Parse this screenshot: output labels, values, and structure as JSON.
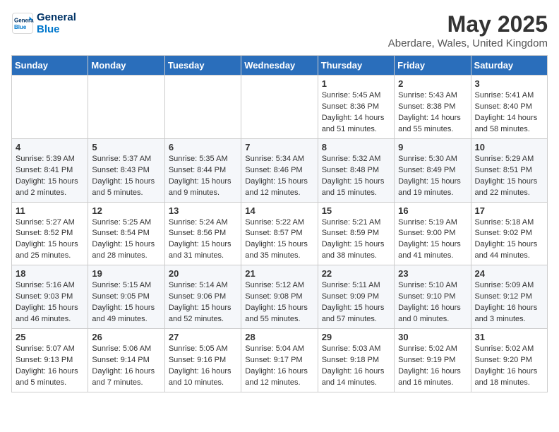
{
  "logo": {
    "line1": "General",
    "line2": "Blue"
  },
  "title": "May 2025",
  "location": "Aberdare, Wales, United Kingdom",
  "days_of_week": [
    "Sunday",
    "Monday",
    "Tuesday",
    "Wednesday",
    "Thursday",
    "Friday",
    "Saturday"
  ],
  "weeks": [
    [
      {
        "day": "",
        "sunrise": "",
        "sunset": "",
        "daylight": ""
      },
      {
        "day": "",
        "sunrise": "",
        "sunset": "",
        "daylight": ""
      },
      {
        "day": "",
        "sunrise": "",
        "sunset": "",
        "daylight": ""
      },
      {
        "day": "",
        "sunrise": "",
        "sunset": "",
        "daylight": ""
      },
      {
        "day": "1",
        "sunrise": "Sunrise: 5:45 AM",
        "sunset": "Sunset: 8:36 PM",
        "daylight": "Daylight: 14 hours and 51 minutes."
      },
      {
        "day": "2",
        "sunrise": "Sunrise: 5:43 AM",
        "sunset": "Sunset: 8:38 PM",
        "daylight": "Daylight: 14 hours and 55 minutes."
      },
      {
        "day": "3",
        "sunrise": "Sunrise: 5:41 AM",
        "sunset": "Sunset: 8:40 PM",
        "daylight": "Daylight: 14 hours and 58 minutes."
      }
    ],
    [
      {
        "day": "4",
        "sunrise": "Sunrise: 5:39 AM",
        "sunset": "Sunset: 8:41 PM",
        "daylight": "Daylight: 15 hours and 2 minutes."
      },
      {
        "day": "5",
        "sunrise": "Sunrise: 5:37 AM",
        "sunset": "Sunset: 8:43 PM",
        "daylight": "Daylight: 15 hours and 5 minutes."
      },
      {
        "day": "6",
        "sunrise": "Sunrise: 5:35 AM",
        "sunset": "Sunset: 8:44 PM",
        "daylight": "Daylight: 15 hours and 9 minutes."
      },
      {
        "day": "7",
        "sunrise": "Sunrise: 5:34 AM",
        "sunset": "Sunset: 8:46 PM",
        "daylight": "Daylight: 15 hours and 12 minutes."
      },
      {
        "day": "8",
        "sunrise": "Sunrise: 5:32 AM",
        "sunset": "Sunset: 8:48 PM",
        "daylight": "Daylight: 15 hours and 15 minutes."
      },
      {
        "day": "9",
        "sunrise": "Sunrise: 5:30 AM",
        "sunset": "Sunset: 8:49 PM",
        "daylight": "Daylight: 15 hours and 19 minutes."
      },
      {
        "day": "10",
        "sunrise": "Sunrise: 5:29 AM",
        "sunset": "Sunset: 8:51 PM",
        "daylight": "Daylight: 15 hours and 22 minutes."
      }
    ],
    [
      {
        "day": "11",
        "sunrise": "Sunrise: 5:27 AM",
        "sunset": "Sunset: 8:52 PM",
        "daylight": "Daylight: 15 hours and 25 minutes."
      },
      {
        "day": "12",
        "sunrise": "Sunrise: 5:25 AM",
        "sunset": "Sunset: 8:54 PM",
        "daylight": "Daylight: 15 hours and 28 minutes."
      },
      {
        "day": "13",
        "sunrise": "Sunrise: 5:24 AM",
        "sunset": "Sunset: 8:56 PM",
        "daylight": "Daylight: 15 hours and 31 minutes."
      },
      {
        "day": "14",
        "sunrise": "Sunrise: 5:22 AM",
        "sunset": "Sunset: 8:57 PM",
        "daylight": "Daylight: 15 hours and 35 minutes."
      },
      {
        "day": "15",
        "sunrise": "Sunrise: 5:21 AM",
        "sunset": "Sunset: 8:59 PM",
        "daylight": "Daylight: 15 hours and 38 minutes."
      },
      {
        "day": "16",
        "sunrise": "Sunrise: 5:19 AM",
        "sunset": "Sunset: 9:00 PM",
        "daylight": "Daylight: 15 hours and 41 minutes."
      },
      {
        "day": "17",
        "sunrise": "Sunrise: 5:18 AM",
        "sunset": "Sunset: 9:02 PM",
        "daylight": "Daylight: 15 hours and 44 minutes."
      }
    ],
    [
      {
        "day": "18",
        "sunrise": "Sunrise: 5:16 AM",
        "sunset": "Sunset: 9:03 PM",
        "daylight": "Daylight: 15 hours and 46 minutes."
      },
      {
        "day": "19",
        "sunrise": "Sunrise: 5:15 AM",
        "sunset": "Sunset: 9:05 PM",
        "daylight": "Daylight: 15 hours and 49 minutes."
      },
      {
        "day": "20",
        "sunrise": "Sunrise: 5:14 AM",
        "sunset": "Sunset: 9:06 PM",
        "daylight": "Daylight: 15 hours and 52 minutes."
      },
      {
        "day": "21",
        "sunrise": "Sunrise: 5:12 AM",
        "sunset": "Sunset: 9:08 PM",
        "daylight": "Daylight: 15 hours and 55 minutes."
      },
      {
        "day": "22",
        "sunrise": "Sunrise: 5:11 AM",
        "sunset": "Sunset: 9:09 PM",
        "daylight": "Daylight: 15 hours and 57 minutes."
      },
      {
        "day": "23",
        "sunrise": "Sunrise: 5:10 AM",
        "sunset": "Sunset: 9:10 PM",
        "daylight": "Daylight: 16 hours and 0 minutes."
      },
      {
        "day": "24",
        "sunrise": "Sunrise: 5:09 AM",
        "sunset": "Sunset: 9:12 PM",
        "daylight": "Daylight: 16 hours and 3 minutes."
      }
    ],
    [
      {
        "day": "25",
        "sunrise": "Sunrise: 5:07 AM",
        "sunset": "Sunset: 9:13 PM",
        "daylight": "Daylight: 16 hours and 5 minutes."
      },
      {
        "day": "26",
        "sunrise": "Sunrise: 5:06 AM",
        "sunset": "Sunset: 9:14 PM",
        "daylight": "Daylight: 16 hours and 7 minutes."
      },
      {
        "day": "27",
        "sunrise": "Sunrise: 5:05 AM",
        "sunset": "Sunset: 9:16 PM",
        "daylight": "Daylight: 16 hours and 10 minutes."
      },
      {
        "day": "28",
        "sunrise": "Sunrise: 5:04 AM",
        "sunset": "Sunset: 9:17 PM",
        "daylight": "Daylight: 16 hours and 12 minutes."
      },
      {
        "day": "29",
        "sunrise": "Sunrise: 5:03 AM",
        "sunset": "Sunset: 9:18 PM",
        "daylight": "Daylight: 16 hours and 14 minutes."
      },
      {
        "day": "30",
        "sunrise": "Sunrise: 5:02 AM",
        "sunset": "Sunset: 9:19 PM",
        "daylight": "Daylight: 16 hours and 16 minutes."
      },
      {
        "day": "31",
        "sunrise": "Sunrise: 5:02 AM",
        "sunset": "Sunset: 9:20 PM",
        "daylight": "Daylight: 16 hours and 18 minutes."
      }
    ]
  ]
}
